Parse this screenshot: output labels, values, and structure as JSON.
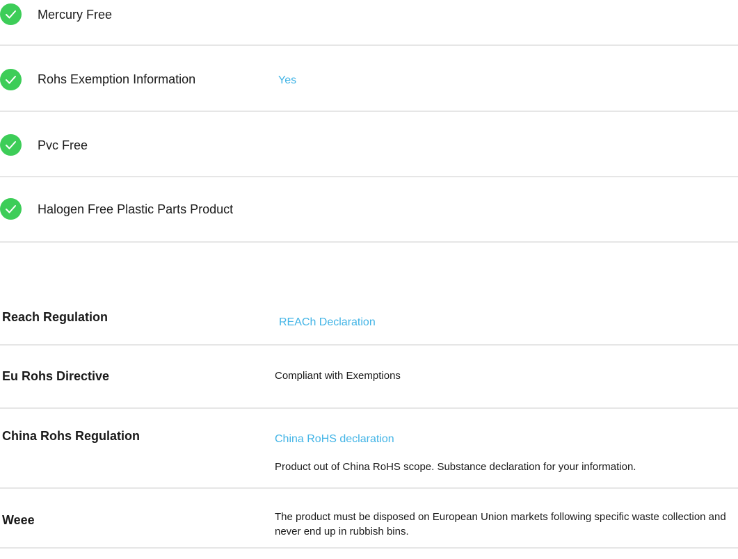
{
  "icons": {
    "check": "check-circle-icon",
    "check_color": "#3dcd58",
    "link_color": "#42b4e6"
  },
  "features": [
    {
      "label": "Mercury Free",
      "value": ""
    },
    {
      "label": "Rohs Exemption Information",
      "value": "Yes"
    },
    {
      "label": "Pvc Free",
      "value": ""
    },
    {
      "label": "Halogen Free Plastic Parts Product",
      "value": ""
    }
  ],
  "regulations": [
    {
      "label": "Reach Regulation",
      "link": "REACh Declaration",
      "text": ""
    },
    {
      "label": "Eu Rohs Directive",
      "link": "",
      "text": "Compliant with Exemptions"
    },
    {
      "label": "China Rohs Regulation",
      "link": "China RoHS declaration",
      "text": "Product out of China RoHS scope. Substance declaration for your information."
    },
    {
      "label": "Weee",
      "link": "",
      "text": "The product must be disposed on European Union markets following specific waste collection and never end up in rubbish bins."
    }
  ]
}
